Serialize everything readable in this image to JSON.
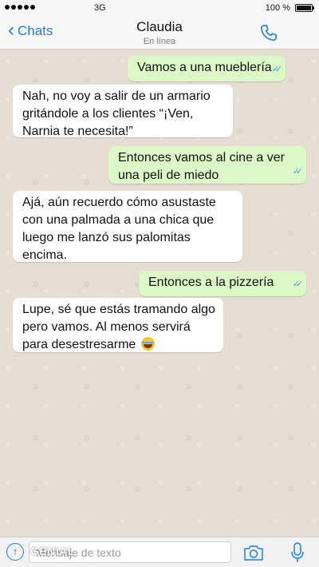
{
  "status_bar": {
    "network": "3G",
    "battery": "100 %",
    "battery_level": 1.0
  },
  "nav": {
    "back_label": "Chats",
    "contact_name": "Claudia",
    "contact_status": "En línea",
    "icons": {
      "back": "chevron-left-icon",
      "call": "phone-icon"
    }
  },
  "messages": [
    {
      "direction": "out",
      "text": "Vamos a una mueblería",
      "read": true
    },
    {
      "direction": "in",
      "text": "Nah, no voy a salir de un armario gritándole a los clientes “¡Ven, Narnia te necesita!”"
    },
    {
      "direction": "out",
      "text": "Entonces vamos al cine a ver una peli de miedo",
      "read": true
    },
    {
      "direction": "in",
      "text": "Ajá, aún recuerdo cómo asustaste con una palmada a una chica que luego me lanzó sus palomitas encima."
    },
    {
      "direction": "out",
      "text": "Entonces a la pizzería",
      "read": true
    },
    {
      "direction": "in",
      "text": "Lupe, sé que estás tramando algo pero vamos. Al menos servirá para desestresarme",
      "emoji": "laughing-tears-emoji"
    }
  ],
  "input": {
    "placeholder": "Mensaje de texto",
    "watermark": "GENIAL",
    "icons": {
      "upload": "upload-icon",
      "camera": "camera-icon",
      "mic": "microphone-icon"
    }
  },
  "colors": {
    "accent": "#1b7fe0",
    "outgoing_bubble": "#dcf8c6",
    "incoming_bubble": "#ffffff",
    "read_ticks": "#3a9ee8",
    "chat_background": "#e6ded3"
  }
}
